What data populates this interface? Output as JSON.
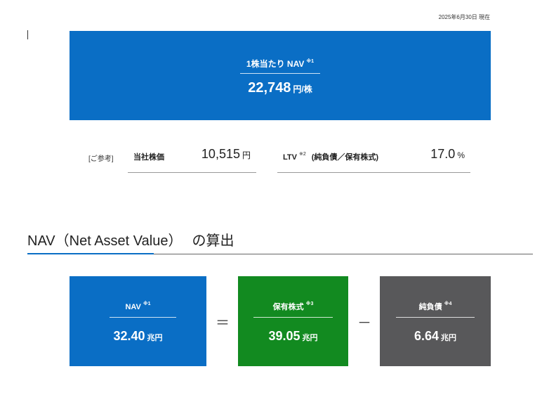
{
  "date_note": "2025年6月30日 現在",
  "hero": {
    "label": "1株当たり NAV",
    "note": "※1",
    "value": "22,748",
    "unit": "円/株"
  },
  "reference": {
    "label": "[ご参考]",
    "stock_price": {
      "label": "当社株価",
      "value": "10,515",
      "unit": "円"
    },
    "ltv": {
      "label": "LTV",
      "note": "※2",
      "formula": "(純負債／保有株式)",
      "value": "17.0",
      "unit": "%"
    }
  },
  "section": {
    "title_en": "NAV（Net Asset Value）",
    "title_jp": "の算出"
  },
  "calc": {
    "nav": {
      "label": "NAV",
      "note": "※1",
      "value": "32.40",
      "unit": "兆円"
    },
    "op_equals": "＝",
    "holdings": {
      "label": "保有株式",
      "note": "※3",
      "value": "39.05",
      "unit": "兆円"
    },
    "op_minus": "－",
    "net_debt": {
      "label": "純負債",
      "note": "※4",
      "value": "6.64",
      "unit": "兆円"
    }
  },
  "colors": {
    "blue": "#0a6ec5",
    "green": "#128a20",
    "gray": "#58585a"
  }
}
